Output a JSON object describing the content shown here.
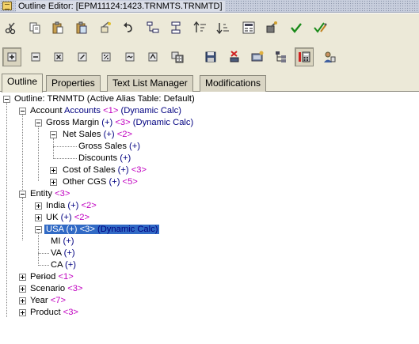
{
  "window": {
    "title": "Outline Editor: [EPM11124:1423.TRNMTS.TRNMTD]"
  },
  "toolbar1": [
    {
      "name": "cut-icon"
    },
    {
      "name": "copy-icon"
    },
    {
      "name": "paste-icon"
    },
    {
      "name": "paste-special-icon"
    },
    {
      "name": "clear-icon"
    },
    {
      "name": "undo-icon"
    },
    {
      "name": "add-child-icon"
    },
    {
      "name": "add-sibling-icon"
    },
    {
      "name": "sort-ascending-icon"
    },
    {
      "name": "sort-descending-icon"
    },
    {
      "name": "properties-icon"
    },
    {
      "name": "find-icon"
    },
    {
      "name": "verify-icon"
    },
    {
      "name": "verify-outline-icon"
    }
  ],
  "toolbar2": [
    {
      "name": "consolidate-add-icon"
    },
    {
      "name": "consolidate-subtract-icon"
    },
    {
      "name": "consolidate-multiply-icon"
    },
    {
      "name": "consolidate-divide-icon"
    },
    {
      "name": "consolidate-percent-icon"
    },
    {
      "name": "consolidate-tilde-icon"
    },
    {
      "name": "consolidate-caret-icon"
    },
    {
      "name": "attribute-calculator-icon"
    },
    {
      "name": "save-icon"
    },
    {
      "name": "delete-icon"
    },
    {
      "name": "dimension-build-icon"
    },
    {
      "name": "tree-structure-icon"
    },
    {
      "name": "calculate-icon"
    },
    {
      "name": "user-settings-icon"
    }
  ],
  "tabs": [
    {
      "label": "Outline",
      "active": true
    },
    {
      "label": "Properties",
      "active": false
    },
    {
      "label": "Text List Manager",
      "active": false
    },
    {
      "label": "Modifications",
      "active": false
    }
  ],
  "tree": {
    "root": "Outline: TRNMTD (Active Alias Table: Default)",
    "account": {
      "name": "Account",
      "alias": "Accounts",
      "tag": "<1>",
      "calc": "(Dynamic Calc)"
    },
    "gross_margin": {
      "name": "Gross Margin",
      "cons": "(+)",
      "tag": "<3>",
      "calc": "(Dynamic Calc)"
    },
    "net_sales": {
      "name": "Net Sales",
      "cons": "(+)",
      "tag": "<2>"
    },
    "gross_sales": {
      "name": "Gross Sales",
      "cons": "(+)"
    },
    "discounts": {
      "name": "Discounts",
      "cons": "(+)"
    },
    "cost_of_sales": {
      "name": "Cost of Sales",
      "cons": "(+)",
      "tag": "<3>"
    },
    "other_cgs": {
      "name": "Other CGS",
      "cons": "(+)",
      "tag": "<5>"
    },
    "entity": {
      "name": "Entity",
      "tag": "<3>"
    },
    "india": {
      "name": "India",
      "cons": "(+)",
      "tag": "<2>"
    },
    "uk": {
      "name": "UK",
      "cons": "(+)",
      "tag": "<2>"
    },
    "usa": {
      "name": "USA",
      "cons": "(+)",
      "tag": "<3>",
      "calc": "(Dynamic Calc)"
    },
    "mi": {
      "name": "MI",
      "cons": "(+)"
    },
    "va": {
      "name": "VA",
      "cons": "(+)"
    },
    "ca": {
      "name": "CA",
      "cons": "(+)"
    },
    "period": {
      "name": "Period",
      "tag": "<1>"
    },
    "scenario": {
      "name": "Scenario",
      "tag": "<3>"
    },
    "year": {
      "name": "Year",
      "tag": "<7>"
    },
    "product": {
      "name": "Product",
      "tag": "<3>"
    }
  },
  "colors": {
    "selection": "#316ac5",
    "member_tag": "#c000c0",
    "consolidation": "#000080",
    "chrome": "#ece9d8"
  }
}
